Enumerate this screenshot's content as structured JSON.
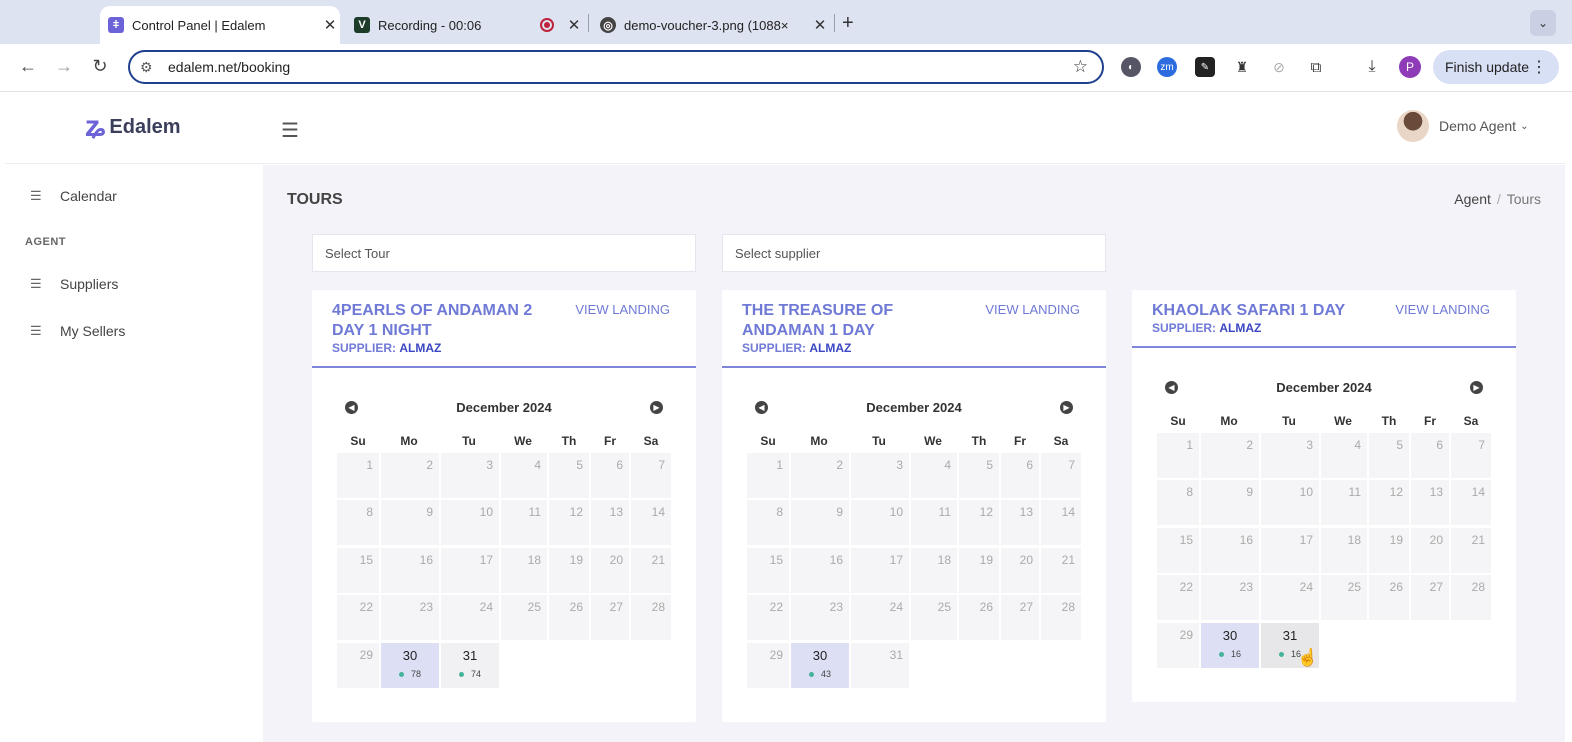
{
  "browser": {
    "tabs": [
      {
        "title": "Control Panel | Edalem",
        "favicon": "edalem-icon",
        "active": true
      },
      {
        "title": "Recording - 00:06",
        "favicon": "v-icon",
        "active": false
      },
      {
        "title": "demo-voucher-3.png (1088×",
        "favicon": "globe-icon",
        "active": false
      }
    ],
    "url": "edalem.net/booking",
    "finish_update": "Finish update",
    "profile_initial": "P"
  },
  "app": {
    "brand": "Edalem",
    "user": "Demo Agent"
  },
  "sidebar": {
    "calendar": "Calendar",
    "section": "AGENT",
    "suppliers": "Suppliers",
    "sellers": "My Sellers"
  },
  "page": {
    "title": "TOURS",
    "breadcrumb": [
      "Agent",
      "Tours"
    ],
    "select_tour": "Select Tour",
    "select_supplier": "Select supplier"
  },
  "cards": [
    {
      "name": "4PEARLS OF ANDAMAN 2 DAY 1 NIGHT",
      "supplier_label": "SUPPLIER:",
      "supplier": "ALMAZ",
      "view": "VIEW LANDING",
      "month": "December 2024",
      "available": [
        {
          "day": 30,
          "seats": "78"
        },
        {
          "day": 31,
          "seats": "74"
        }
      ]
    },
    {
      "name": "THE TREASURE OF ANDAMAN 1 DAY",
      "supplier_label": "SUPPLIER:",
      "supplier": "ALMAZ",
      "view": "VIEW LANDING",
      "month": "December 2024",
      "available": [
        {
          "day": 30,
          "seats": "43"
        }
      ]
    },
    {
      "name": "KHAOLAK SAFARI 1 DAY",
      "supplier_label": "SUPPLIER:",
      "supplier": "ALMAZ",
      "view": "VIEW LANDING",
      "month": "December 2024",
      "available": [
        {
          "day": 30,
          "seats": "16"
        },
        {
          "day": 31,
          "seats": "16"
        }
      ]
    }
  ],
  "weekdays": [
    "Su",
    "Mo",
    "Tu",
    "We",
    "Th",
    "Fr",
    "Sa"
  ],
  "colors": {
    "accent": "#6f79d6",
    "available": "#dde0f5",
    "seat_dot": "#44b39a"
  }
}
